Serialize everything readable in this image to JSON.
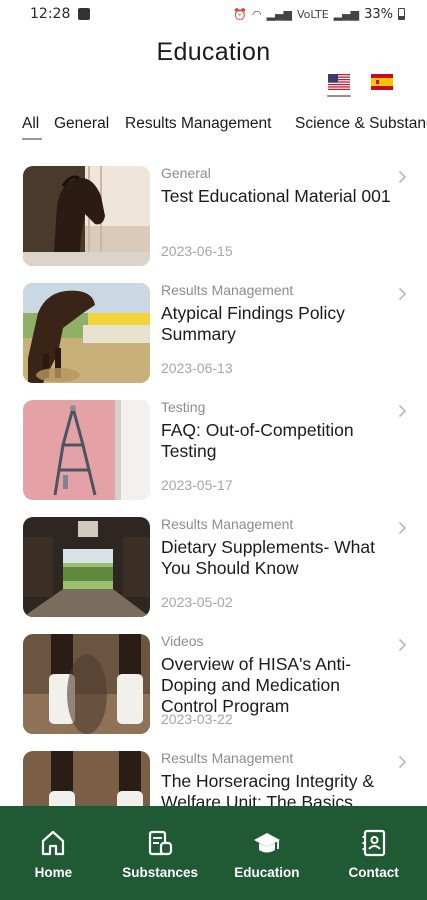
{
  "status_bar": {
    "time": "12:28",
    "network": "VoLTE",
    "battery": "33%"
  },
  "page": {
    "title": "Education"
  },
  "languages": [
    {
      "code": "en",
      "flag": "us-flag-icon",
      "selected": true
    },
    {
      "code": "es",
      "flag": "spain-flag-icon",
      "selected": false
    }
  ],
  "tabs": [
    {
      "label": "All",
      "selected": true
    },
    {
      "label": "General",
      "selected": false
    },
    {
      "label": "Results Management",
      "selected": false
    },
    {
      "label": "Science & Substances",
      "selected": false
    }
  ],
  "items": [
    {
      "category": "General",
      "title": "Test Educational Material 001",
      "date": "2023-06-15",
      "thumbnail": "horse-in-stall-image"
    },
    {
      "category": "Results Management",
      "title": "Atypical Findings Policy Summary",
      "date": "2023-06-13",
      "thumbnail": "horse-jumping-image"
    },
    {
      "category": "Testing",
      "title": "FAQ: Out-of-Competition Testing",
      "date": "2023-05-17",
      "thumbnail": "halter-on-wall-image"
    },
    {
      "category": "Results Management",
      "title": "Dietary Supplements- What You Should Know",
      "date": "2023-05-02",
      "thumbnail": "barn-aisle-image"
    },
    {
      "category": "Videos",
      "title": "Overview of HISA's Anti-Doping and Medication Control Program",
      "date": "2023-03-22",
      "thumbnail": "horse-legs-wraps-image"
    },
    {
      "category": "Results Management",
      "title": "The Horseracing Integrity & Welfare Unit: The Basics",
      "date": "",
      "thumbnail": "horse-legs-wraps-image"
    }
  ],
  "bottom_nav": [
    {
      "label": "Home",
      "icon": "home-icon",
      "selected": false
    },
    {
      "label": "Substances",
      "icon": "substances-icon",
      "selected": false
    },
    {
      "label": "Education",
      "icon": "graduation-cap-icon",
      "selected": true
    },
    {
      "label": "Contact",
      "icon": "contact-book-icon",
      "selected": false
    }
  ],
  "colors": {
    "nav_background": "#1f5a35",
    "category_text": "#8d8d8d",
    "date_text": "#a6a6a6"
  }
}
